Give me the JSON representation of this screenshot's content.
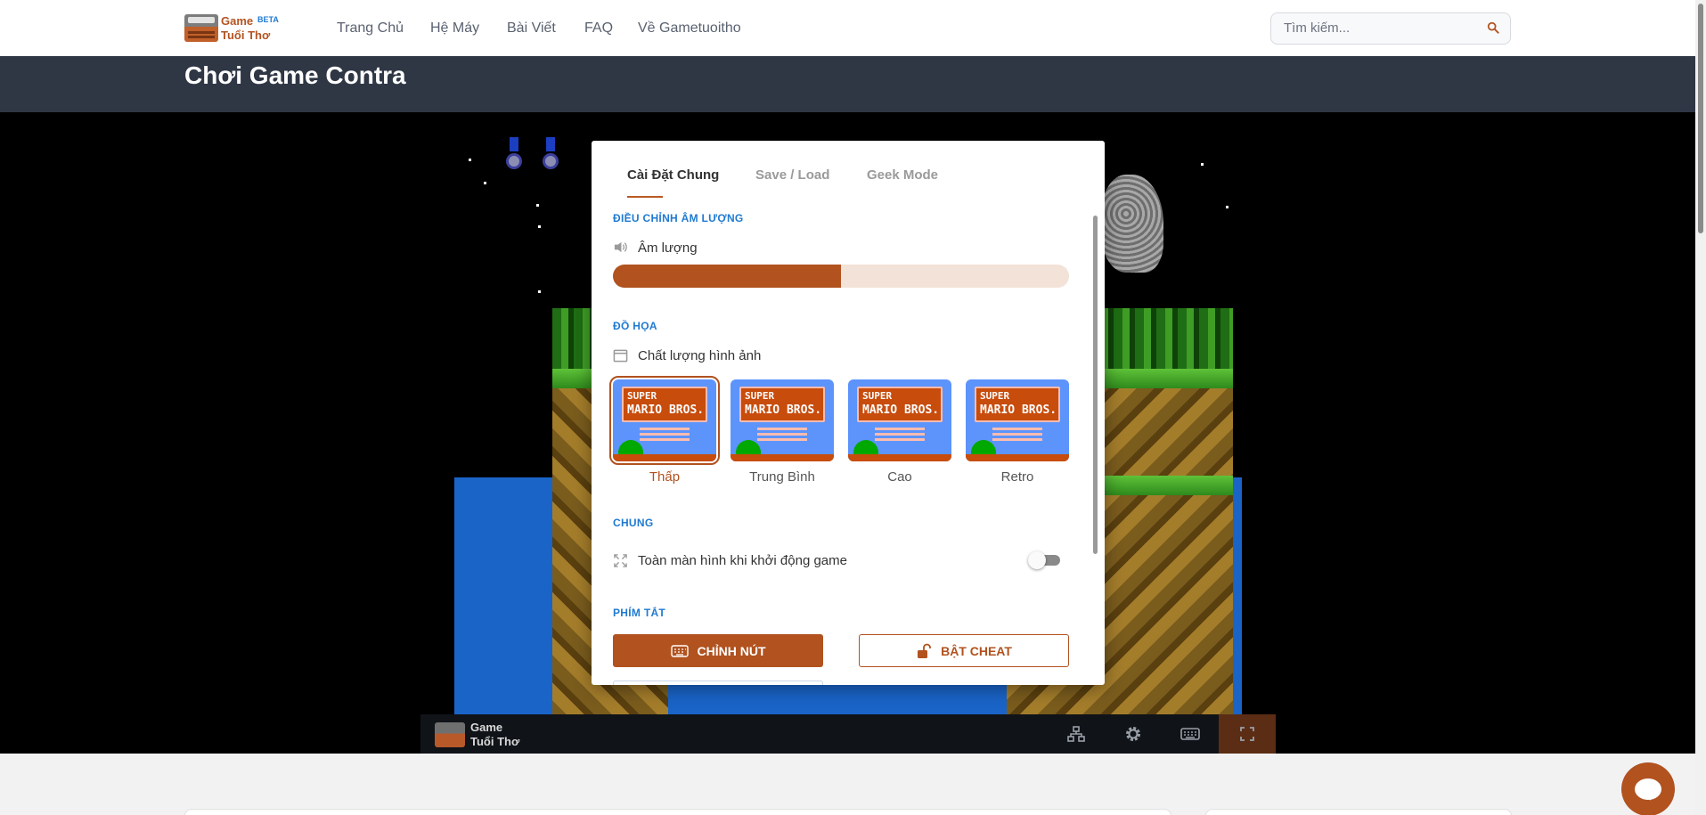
{
  "brand": {
    "line1": "Game",
    "badge": "BETA",
    "line2": "Tuổi Thơ"
  },
  "nav": {
    "items": [
      "Trang Chủ",
      "Hệ Máy",
      "Bài Viết",
      "FAQ",
      "Về Gametuoitho"
    ]
  },
  "search": {
    "placeholder": "Tìm kiếm..."
  },
  "page": {
    "title": "Chơi Game Contra"
  },
  "settings": {
    "tabs": [
      "Cài Đặt Chung",
      "Save / Load",
      "Geek Mode"
    ],
    "active_tab": "Cài Đặt Chung",
    "volume": {
      "section": "ĐIỀU CHỈNH ÂM LƯỢNG",
      "label": "Âm lượng",
      "level": 0.5,
      "icon": "speaker-icon"
    },
    "graphics": {
      "section": "ĐỒ HỌA",
      "label": "Chất lượng hình ảnh",
      "icon": "window-icon",
      "options": [
        "Thấp",
        "Trung Bình",
        "Cao",
        "Retro"
      ],
      "selected": "Thấp",
      "preview_line1": "SUPER",
      "preview_line2": "MARIO BROS."
    },
    "general": {
      "section": "CHUNG",
      "fullscreen_label": "Toàn màn hình khi khởi động game",
      "fullscreen_on": false,
      "icon": "expand-icon"
    },
    "shortcuts": {
      "section": "PHÍM TẮT",
      "remap_button": "CHỈNH NÚT",
      "cheat_button": "BẬT CHEAT"
    }
  },
  "toolbar": {
    "logo_line1": "Game",
    "logo_line2": "Tuổi Thơ",
    "buttons": [
      "network-icon",
      "gear-icon",
      "keyboard-icon",
      "fullscreen-icon"
    ]
  },
  "colors": {
    "accent": "#b1521f",
    "section_blue": "#1f7ad1",
    "title_band": "#2f3745",
    "game_bg": "#000000"
  }
}
